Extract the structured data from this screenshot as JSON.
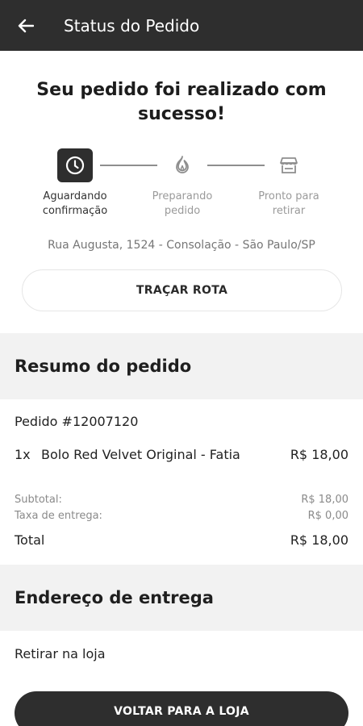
{
  "appbar": {
    "title": "Status do Pedido",
    "back_icon": "arrow-left-icon"
  },
  "hero": {
    "title": "Seu pedido foi realizado com sucesso!"
  },
  "steps": [
    {
      "label": "Aguardando confirmação",
      "icon": "clock-icon",
      "active": true
    },
    {
      "label": "Preparando pedido",
      "icon": "flame-icon",
      "active": false
    },
    {
      "label": "Pronto para retirar",
      "icon": "store-icon",
      "active": false
    }
  ],
  "store_address": "Rua Augusta, 1524 - Consolação - São Paulo/SP",
  "route_button": "TRAÇAR ROTA",
  "summary": {
    "heading": "Resumo do pedido",
    "order_number": "Pedido #12007120",
    "items": [
      {
        "qty": "1x",
        "name": "Bolo Red Velvet Original - Fatia",
        "price": "R$ 18,00"
      }
    ],
    "subtotal_label": "Subtotal:",
    "subtotal_value": "R$ 18,00",
    "delivery_label": "Taxa de entrega:",
    "delivery_value": "R$ 0,00",
    "total_label": "Total",
    "total_value": "R$ 18,00"
  },
  "delivery": {
    "heading": "Endereço de entrega",
    "value": "Retirar na loja"
  },
  "footer_button": "VOLTAR PARA A LOJA",
  "colors": {
    "dark": "#2e2e2e",
    "section_bg": "#f2f2f2",
    "muted": "#9a9a9a"
  }
}
